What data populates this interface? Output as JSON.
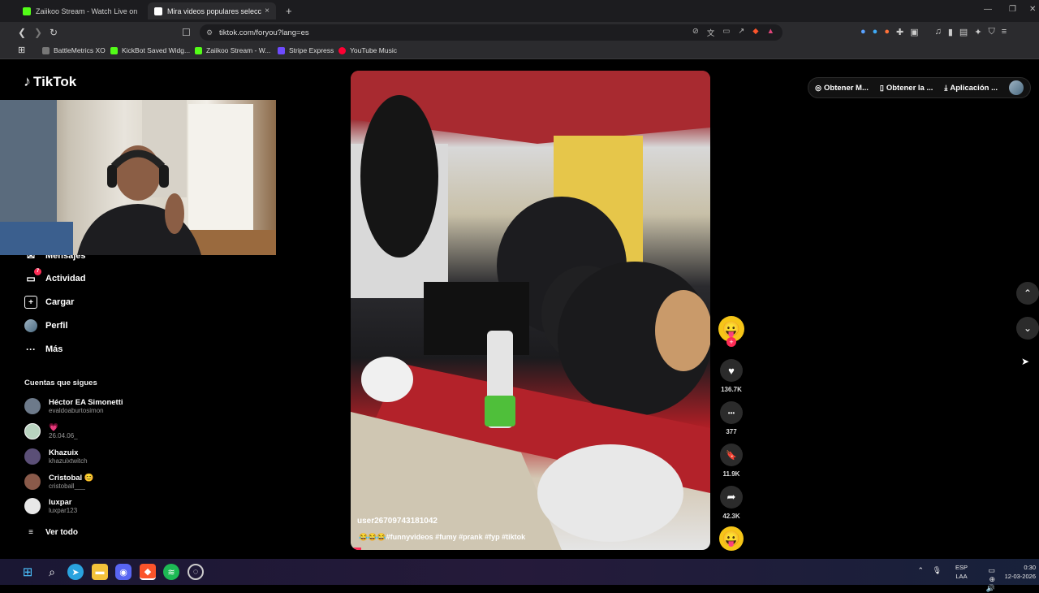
{
  "browser": {
    "tabs": [
      {
        "title": "Zaiikoo Stream - Watch Live on Kick",
        "favicon_color": "#53fc18"
      },
      {
        "title": "Mira videos populares selecc",
        "favicon_color": "#ffffff",
        "close": "×"
      }
    ],
    "new_tab": "+",
    "window_controls": {
      "minimize": "—",
      "maximize": "❐",
      "close": "✕"
    },
    "url": "tiktok.com/foryou?lang=es",
    "bookmarks": [
      {
        "label": "BattleMetrics XO",
        "color": "#777777"
      },
      {
        "label": "KickBot Saved Widg...",
        "color": "#53fc18"
      },
      {
        "label": "Zaiikoo Stream - W...",
        "color": "#53fc18"
      },
      {
        "label": "Stripe Express",
        "color": "#6e4bff"
      },
      {
        "label": "YouTube Music",
        "color": "#ff0033"
      }
    ]
  },
  "tiktok": {
    "logo": "TikTok",
    "nav": [
      {
        "label": "Mensajes",
        "icon": "message-icon"
      },
      {
        "label": "Actividad",
        "icon": "activity-icon",
        "badge": "7"
      },
      {
        "label": "Cargar",
        "icon": "upload-icon"
      },
      {
        "label": "Perfil",
        "icon": "profile-icon"
      },
      {
        "label": "Más",
        "icon": "more-icon"
      }
    ],
    "following_title": "Cuentas que sigues",
    "following": [
      {
        "name": "Héctor EA Simonetti",
        "handle": "evaldoaburtosimon",
        "color": "#6d7a8a"
      },
      {
        "name": "💗",
        "handle": "26.04.06_",
        "color": "#b9d3c0"
      },
      {
        "name": "Khazuix",
        "handle": "khazuixtwitch",
        "color": "#5b4f77"
      },
      {
        "name": "Cristobal 😊",
        "handle": "cristoball___",
        "color": "#8a5a4a"
      },
      {
        "name": "luxpar",
        "handle": "luxpar123",
        "color": "#e8e8e8"
      }
    ],
    "see_all": "Ver todo",
    "topbar": [
      {
        "label": "Obtener M...",
        "icon": "coin-icon"
      },
      {
        "label": "Obtener la ...",
        "icon": "phone-icon"
      },
      {
        "label": "Aplicación ...",
        "icon": "download-icon"
      }
    ],
    "video": {
      "user": "user2670974318104​2",
      "caption": "😂😂😂#funnyvideos #fumy #prank #fyp #tiktok",
      "progress": 0.03
    },
    "actions": [
      {
        "icon": "like-icon",
        "glyph": "♥",
        "count": "136.7K"
      },
      {
        "icon": "comment-icon",
        "glyph": "•••",
        "count": "377"
      },
      {
        "icon": "bookmark-icon",
        "glyph": "🔖",
        "count": "11.9K"
      },
      {
        "icon": "share-icon",
        "glyph": "➦",
        "count": "42.3K"
      }
    ]
  },
  "taskbar": {
    "lang": "ESP",
    "lang2": "LAA",
    "time": "0:30",
    "date": "12-03-2026"
  }
}
